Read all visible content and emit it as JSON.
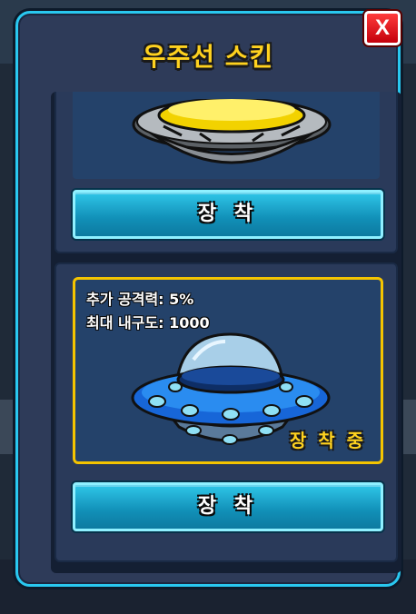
{
  "popup": {
    "title": "우주선 스킨",
    "close_label": "X"
  },
  "skins": [
    {
      "equip_label": "장 착",
      "colors": {
        "rim": "#f2d200",
        "body": "#9ea3a8"
      }
    },
    {
      "stat_attack": "추가 공격력: 5%",
      "stat_durability": "최대 내구도: 1000",
      "status_badge": "장 착 중",
      "equip_label": "장 착",
      "colors": {
        "rim": "#2a8cf0",
        "body": "#1766d8",
        "dome": "#a8cfe8",
        "lights": "#8fe0f5"
      }
    }
  ],
  "theme": {
    "panel_border": "#29c8f0",
    "title_color": "#ffd21f",
    "selected_border": "#f5c400",
    "close_button": "#e01818"
  }
}
